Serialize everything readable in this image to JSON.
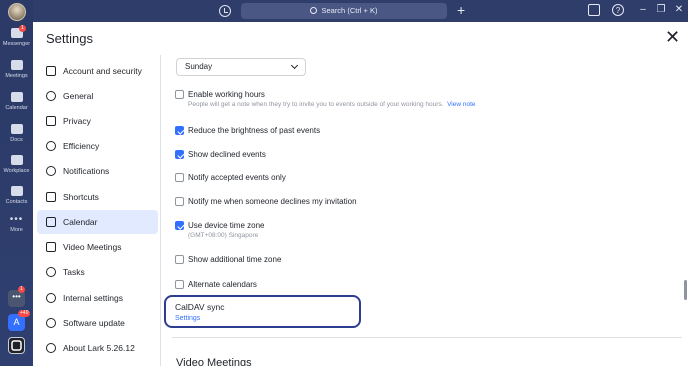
{
  "rail": {
    "items": [
      {
        "label": "Messenger",
        "badge": "1"
      },
      {
        "label": "Meetings"
      },
      {
        "label": "Calendar"
      },
      {
        "label": "Docs"
      },
      {
        "label": "Workplace"
      },
      {
        "label": "Contacts"
      },
      {
        "label": "More"
      }
    ],
    "app_badges": {
      "app1": "1",
      "app2": "+40",
      "app2_letter": "A"
    }
  },
  "topbar": {
    "search_placeholder": "Search (Ctrl + K)"
  },
  "settings": {
    "title": "Settings",
    "nav": [
      {
        "label": "Account and security"
      },
      {
        "label": "General"
      },
      {
        "label": "Privacy"
      },
      {
        "label": "Efficiency"
      },
      {
        "label": "Notifications"
      },
      {
        "label": "Shortcuts"
      },
      {
        "label": "Calendar",
        "active": true
      },
      {
        "label": "Video Meetings"
      },
      {
        "label": "Tasks"
      },
      {
        "label": "Internal settings"
      },
      {
        "label": "Software update"
      },
      {
        "label": "About Lark 5.26.12"
      }
    ],
    "calendar": {
      "week_start": "Sunday",
      "options": [
        {
          "label": "Enable working hours",
          "checked": false,
          "sub": "People will get a note when they try to invite you to events outside of your working hours.",
          "sub_link": "View note"
        },
        {
          "label": "Reduce the brightness of past events",
          "checked": true
        },
        {
          "label": "Show declined events",
          "checked": true
        },
        {
          "label": "Notify accepted events only",
          "checked": false
        },
        {
          "label": "Notify me when someone declines my invitation",
          "checked": false
        },
        {
          "label": "Use device time zone",
          "checked": true,
          "sub": "(GMT+08:00) Singapore"
        },
        {
          "label": "Show additional time zone",
          "checked": false
        },
        {
          "label": "Alternate calendars",
          "checked": false
        }
      ],
      "caldav": {
        "title": "CalDAV sync",
        "link": "Settings"
      },
      "next_section": "Video Meetings"
    }
  }
}
